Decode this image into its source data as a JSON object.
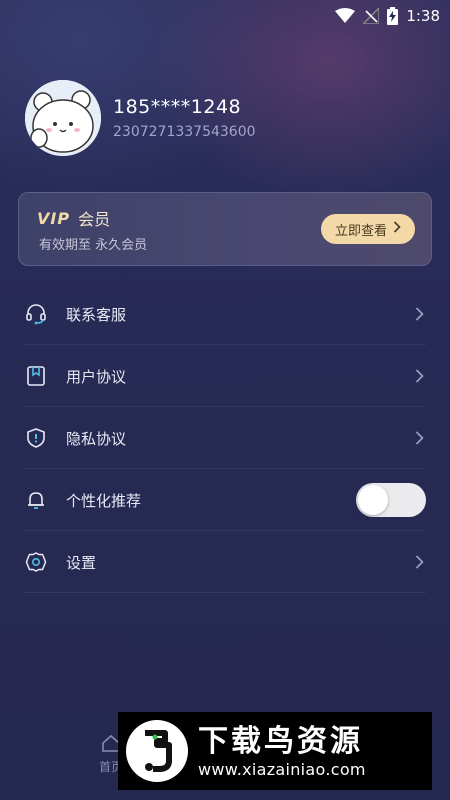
{
  "status_bar": {
    "time": "1:38",
    "icons": [
      "wifi-icon",
      "no-signal-icon",
      "battery-charging-icon"
    ]
  },
  "profile": {
    "phone": "185****1248",
    "uid": "2307271337543600"
  },
  "vip": {
    "logo": "VIP",
    "label": "会员",
    "validity": "有效期至 永久会员",
    "button_label": "立即查看",
    "accent": "#f3d8a8"
  },
  "menu": {
    "items": [
      {
        "label": "联系客服",
        "icon": "headset-icon",
        "control": "chevron"
      },
      {
        "label": "用户协议",
        "icon": "bookmark-icon",
        "control": "chevron"
      },
      {
        "label": "隐私协议",
        "icon": "shield-icon",
        "control": "chevron"
      },
      {
        "label": "个性化推荐",
        "icon": "bell-icon",
        "control": "toggle",
        "toggle_on": false
      },
      {
        "label": "设置",
        "icon": "gear-icon",
        "control": "chevron"
      }
    ]
  },
  "tabbar": {
    "home_label": "首页"
  },
  "watermark": {
    "title": "下载鸟资源",
    "url": "www.xiazainiao.com"
  }
}
